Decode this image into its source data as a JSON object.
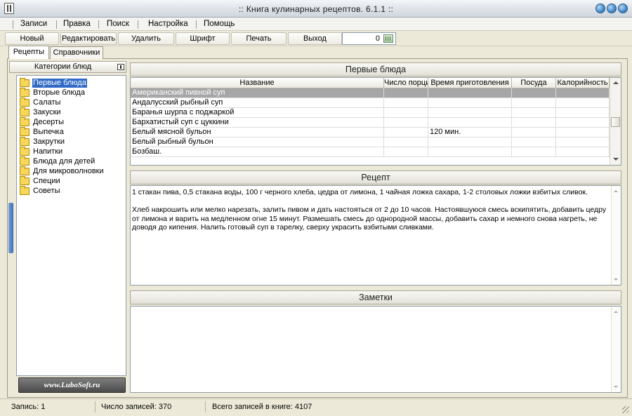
{
  "window": {
    "title": ":: Книга кулинарных рецептов. 6.1.1 ::"
  },
  "menu": {
    "items": [
      "Записи",
      "Правка",
      "Поиск",
      "Настройка",
      "Помощь"
    ]
  },
  "toolbar": {
    "new_label": "Новый",
    "edit_label": "Редактировать",
    "delete_label": "Удалить",
    "font_label": "Шрифт",
    "print_label": "Печать",
    "exit_label": "Выход",
    "counter_value": "0"
  },
  "tabs": [
    "Рецепты",
    "Справочники"
  ],
  "categories": {
    "header": "Категории блюд",
    "items": [
      "Первые блюда",
      "Вторые блюда",
      "Салаты",
      "Закуски",
      "Десерты",
      "Выпечка",
      "Закрутки",
      "Напитки",
      "Блюда для детей",
      "Для микроволновки",
      "Специи",
      "Советы"
    ],
    "selected_index": 0,
    "logo_text": "www.LuboSoft.ru"
  },
  "dishes": {
    "section_title": "Первые блюда",
    "columns": [
      "Название",
      "Число порций",
      "Время приготовления",
      "Посуда",
      "Калорийность"
    ],
    "rows": [
      [
        "Американский пивной суп",
        "",
        "",
        "",
        ""
      ],
      [
        "Андалусский рыбный суп",
        "",
        "",
        "",
        ""
      ],
      [
        "Баранья шурпа с поджаркой",
        "",
        "",
        "",
        ""
      ],
      [
        "Бархатистый суп с цуккини",
        "",
        "",
        "",
        ""
      ],
      [
        "Белый мясной бульон",
        "",
        "120 мин.",
        "",
        ""
      ],
      [
        "Белый рыбный бульон",
        "",
        "",
        "",
        ""
      ],
      [
        "Бозбаш.",
        "",
        "",
        "",
        ""
      ]
    ],
    "selected_row": 0
  },
  "recipe": {
    "section_title": "Рецепт",
    "text": "1 стакан пива, 0,5 стакана воды, 100 г черного хлеба, цедра от лимона, 1 чайная ложка сахара, 1-2 столовых ложки взбитых сливок.\n\nХлеб накрошить или мелко нарезать, залить пивом и дать настояться от 2 до 10 часов. Настоявшуюся смесь вскипятить, добавить цедру от лимона и варить на медленном огне 15 минут. Размешать смесь до однородной массы, добавить сахар и немного снова нагреть, не доводя до кипения. Налить готовый суп в тарелку, сверху украсить взбитыми сливками."
  },
  "notes": {
    "section_title": "Заметки",
    "text": ""
  },
  "status": {
    "record": "Запись: 1",
    "count": "Число записей: 370",
    "total": "Всего записей в книге: 4107"
  }
}
